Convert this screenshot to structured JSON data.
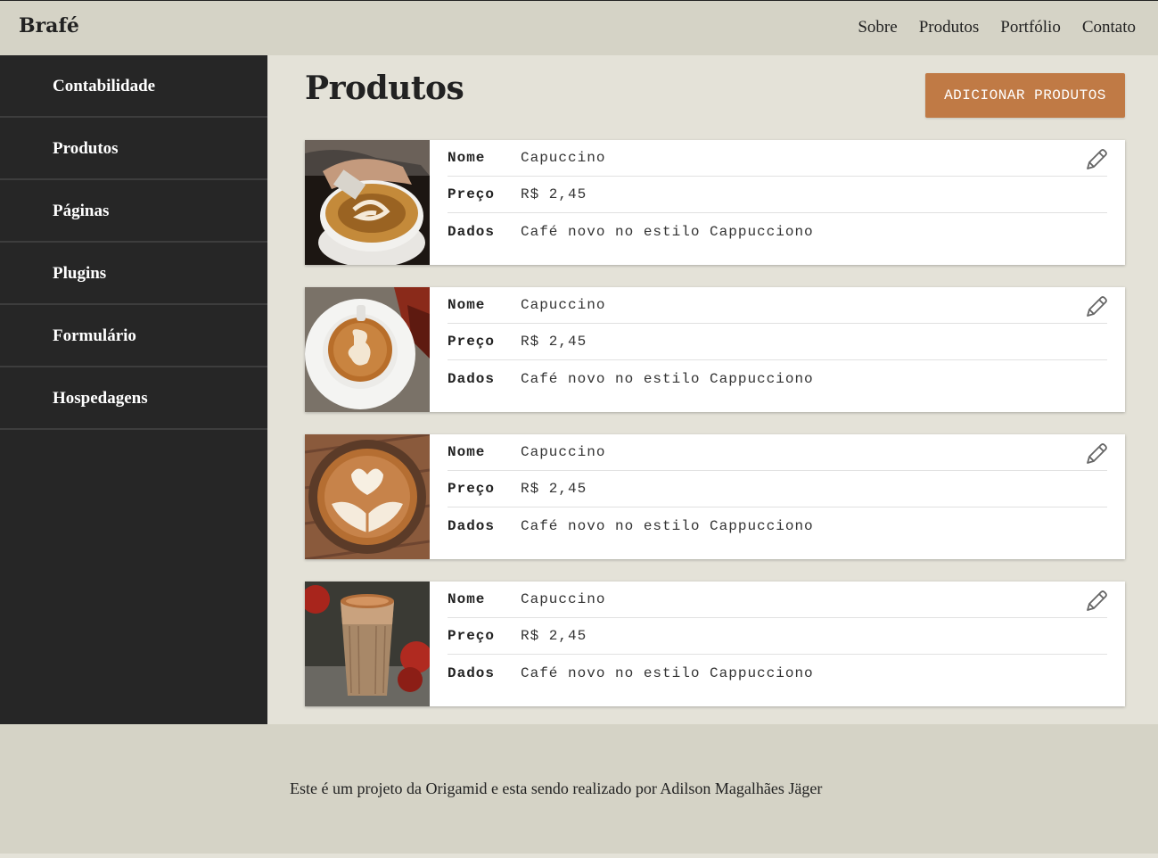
{
  "header": {
    "logo": "Brafé",
    "nav": [
      "Sobre",
      "Produtos",
      "Portfólio",
      "Contato"
    ]
  },
  "sidebar": {
    "items": [
      {
        "label": "Contabilidade"
      },
      {
        "label": "Produtos"
      },
      {
        "label": "Páginas"
      },
      {
        "label": "Plugins"
      },
      {
        "label": "Formulário"
      },
      {
        "label": "Hospedagens"
      }
    ]
  },
  "main": {
    "title": "Produtos",
    "add_button": "ADICIONAR PRODUTOS",
    "products": [
      {
        "nome_label": "Nome",
        "nome": "Capuccino",
        "preco_label": "Preço",
        "preco": "R$ 2,45",
        "dados_label": "Dados",
        "dados": "Café novo no estilo Cappucciono",
        "image": "latte-pour"
      },
      {
        "nome_label": "Nome",
        "nome": "Capuccino",
        "preco_label": "Preço",
        "preco": "R$ 2,45",
        "dados_label": "Dados",
        "dados": "Café novo no estilo Cappucciono",
        "image": "latte-art-saucer"
      },
      {
        "nome_label": "Nome",
        "nome": "Capuccino",
        "preco_label": "Preço",
        "preco": "R$ 2,45",
        "dados_label": "Dados",
        "dados": "Café novo no estilo Cappucciono",
        "image": "latte-heart-wood"
      },
      {
        "nome_label": "Nome",
        "nome": "Capuccino",
        "preco_label": "Preço",
        "preco": "R$ 2,45",
        "dados_label": "Dados",
        "dados": "Café novo no estilo Cappucciono",
        "image": "latte-glass"
      }
    ]
  },
  "footer": {
    "text": "Este é um projeto da Origamid e esta sendo realizado por Adilson Magalhães Jäger"
  },
  "colors": {
    "accent": "#c07a45",
    "sidebar": "#262626",
    "header": "#d5d3c6",
    "background": "#e4e2d8"
  }
}
